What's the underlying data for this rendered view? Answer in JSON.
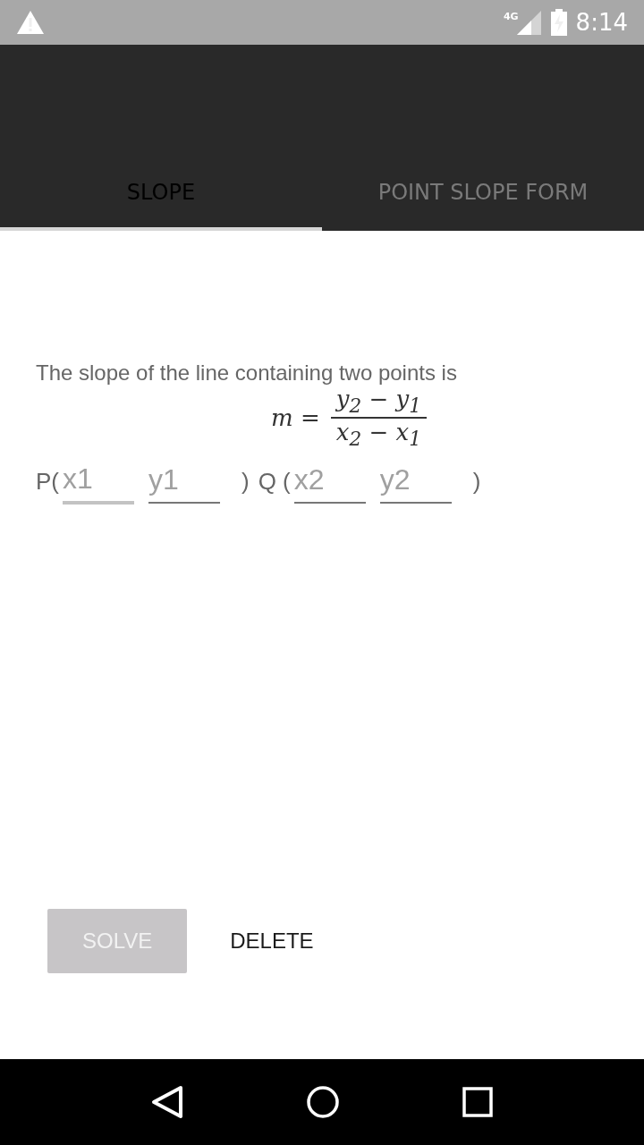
{
  "status_bar": {
    "network": "4G",
    "time": "8:14"
  },
  "tabs": [
    {
      "label": "SLOPE",
      "selected": true
    },
    {
      "label": "POINT SLOPE FORM",
      "selected": false
    }
  ],
  "intro": "The slope of the line containing two points is",
  "formula": {
    "lhs": "m =",
    "numerator": "y$_{2}$ − y$_{1}$",
    "denominator": "x$_{2}$ − x$_{1}$"
  },
  "points": [
    {
      "label": "P(",
      "fields": [
        {
          "placeholder": "x1",
          "focused": true
        },
        {
          "placeholder": "y1",
          "focused": false
        }
      ],
      "close": ")"
    },
    {
      "label": "Q (",
      "fields": [
        {
          "placeholder": "x2",
          "focused": false
        },
        {
          "placeholder": "y2",
          "focused": false
        }
      ],
      "close": ")"
    }
  ],
  "buttons": [
    {
      "label": "SOLVE",
      "kind": "raised",
      "disabled": true
    },
    {
      "label": "DELETE",
      "kind": "flat",
      "disabled": false
    }
  ]
}
